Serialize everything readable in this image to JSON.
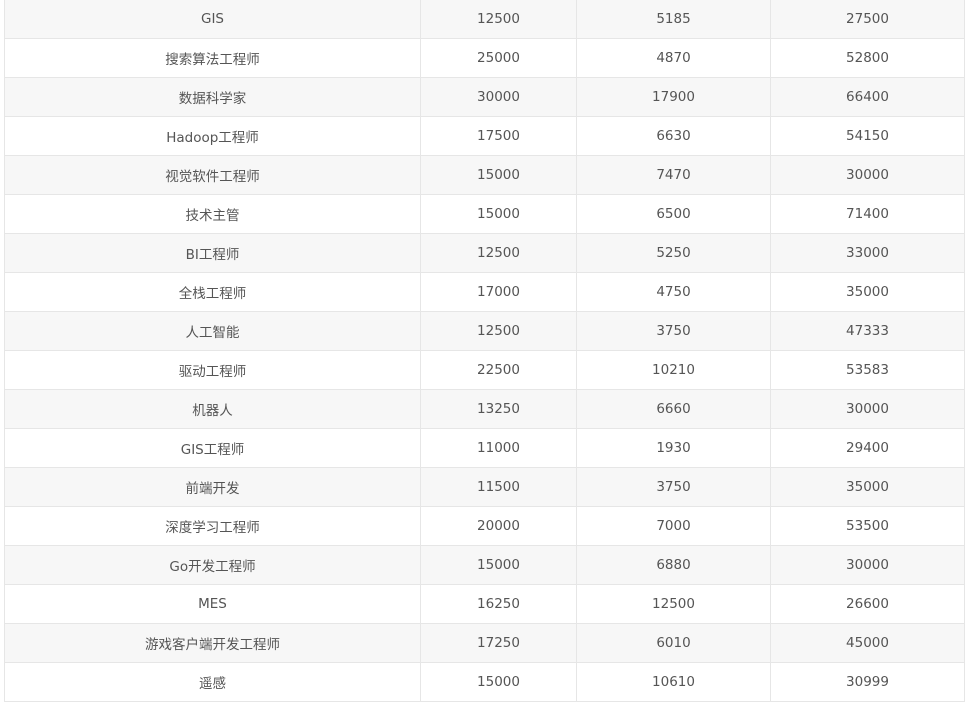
{
  "table": {
    "rows": [
      [
        "GIS",
        "12500",
        "5185",
        "27500"
      ],
      [
        "搜索算法工程师",
        "25000",
        "4870",
        "52800"
      ],
      [
        "数据科学家",
        "30000",
        "17900",
        "66400"
      ],
      [
        "Hadoop工程师",
        "17500",
        "6630",
        "54150"
      ],
      [
        "视觉软件工程师",
        "15000",
        "7470",
        "30000"
      ],
      [
        "技术主管",
        "15000",
        "6500",
        "71400"
      ],
      [
        "BI工程师",
        "12500",
        "5250",
        "33000"
      ],
      [
        "全栈工程师",
        "17000",
        "4750",
        "35000"
      ],
      [
        "人工智能",
        "12500",
        "3750",
        "47333"
      ],
      [
        "驱动工程师",
        "22500",
        "10210",
        "53583"
      ],
      [
        "机器人",
        "13250",
        "6660",
        "30000"
      ],
      [
        "GIS工程师",
        "11000",
        "1930",
        "29400"
      ],
      [
        "前端开发",
        "11500",
        "3750",
        "35000"
      ],
      [
        "深度学习工程师",
        "20000",
        "7000",
        "53500"
      ],
      [
        "Go开发工程师",
        "15000",
        "6880",
        "30000"
      ],
      [
        "MES",
        "16250",
        "12500",
        "26600"
      ],
      [
        "游戏客户端开发工程师",
        "17250",
        "6010",
        "45000"
      ],
      [
        "遥感",
        "15000",
        "10610",
        "30999"
      ]
    ]
  }
}
